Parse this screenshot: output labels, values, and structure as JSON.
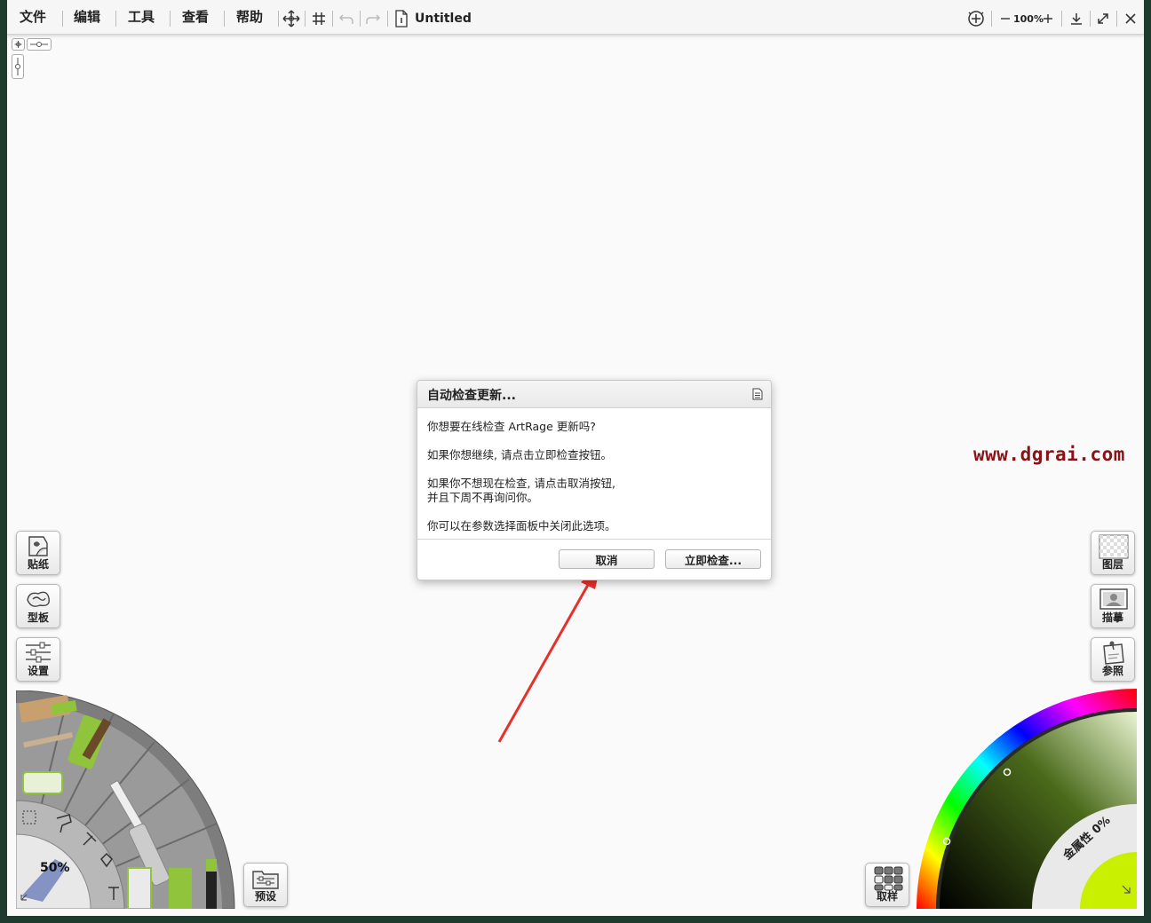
{
  "menu": {
    "file": "文件",
    "edit": "编辑",
    "tools": "工具",
    "view": "查看",
    "help": "帮助"
  },
  "document": {
    "title": "Untitled"
  },
  "zoom": {
    "value": "100%"
  },
  "left_panel": {
    "stickers": "贴纸",
    "stencils": "型板",
    "settings": "设置",
    "presets": "预设"
  },
  "right_panel": {
    "layers": "图层",
    "tracing": "描摹",
    "reference": "参照",
    "sampler": "取样"
  },
  "tool_wheel": {
    "size_label": "50%"
  },
  "color_picker": {
    "metallic_label": "金属性 0%",
    "hue_colors": [
      "#ff0000",
      "#ff00ff",
      "#0000ff",
      "#00ffff",
      "#00ff00",
      "#ffff00",
      "#ff0000"
    ]
  },
  "dialog": {
    "title": "自动检查更新...",
    "line1": "你想要在线检查 ArtRage 更新吗?",
    "line2": "如果你想继续, 请点击立即检查按钮。",
    "line3": "如果你不想现在检查, 请点击取消按钮,",
    "line4": "并且下周不再询问你。",
    "line5": "你可以在参数选择面板中关闭此选项。",
    "cancel": "取消",
    "check_now": "立即检查..."
  },
  "watermark": "www.dgrai.com",
  "colors": {
    "accent_arrow": "#e8302a",
    "watermark": "#8a1216",
    "tool_green": "#8fc43c"
  }
}
